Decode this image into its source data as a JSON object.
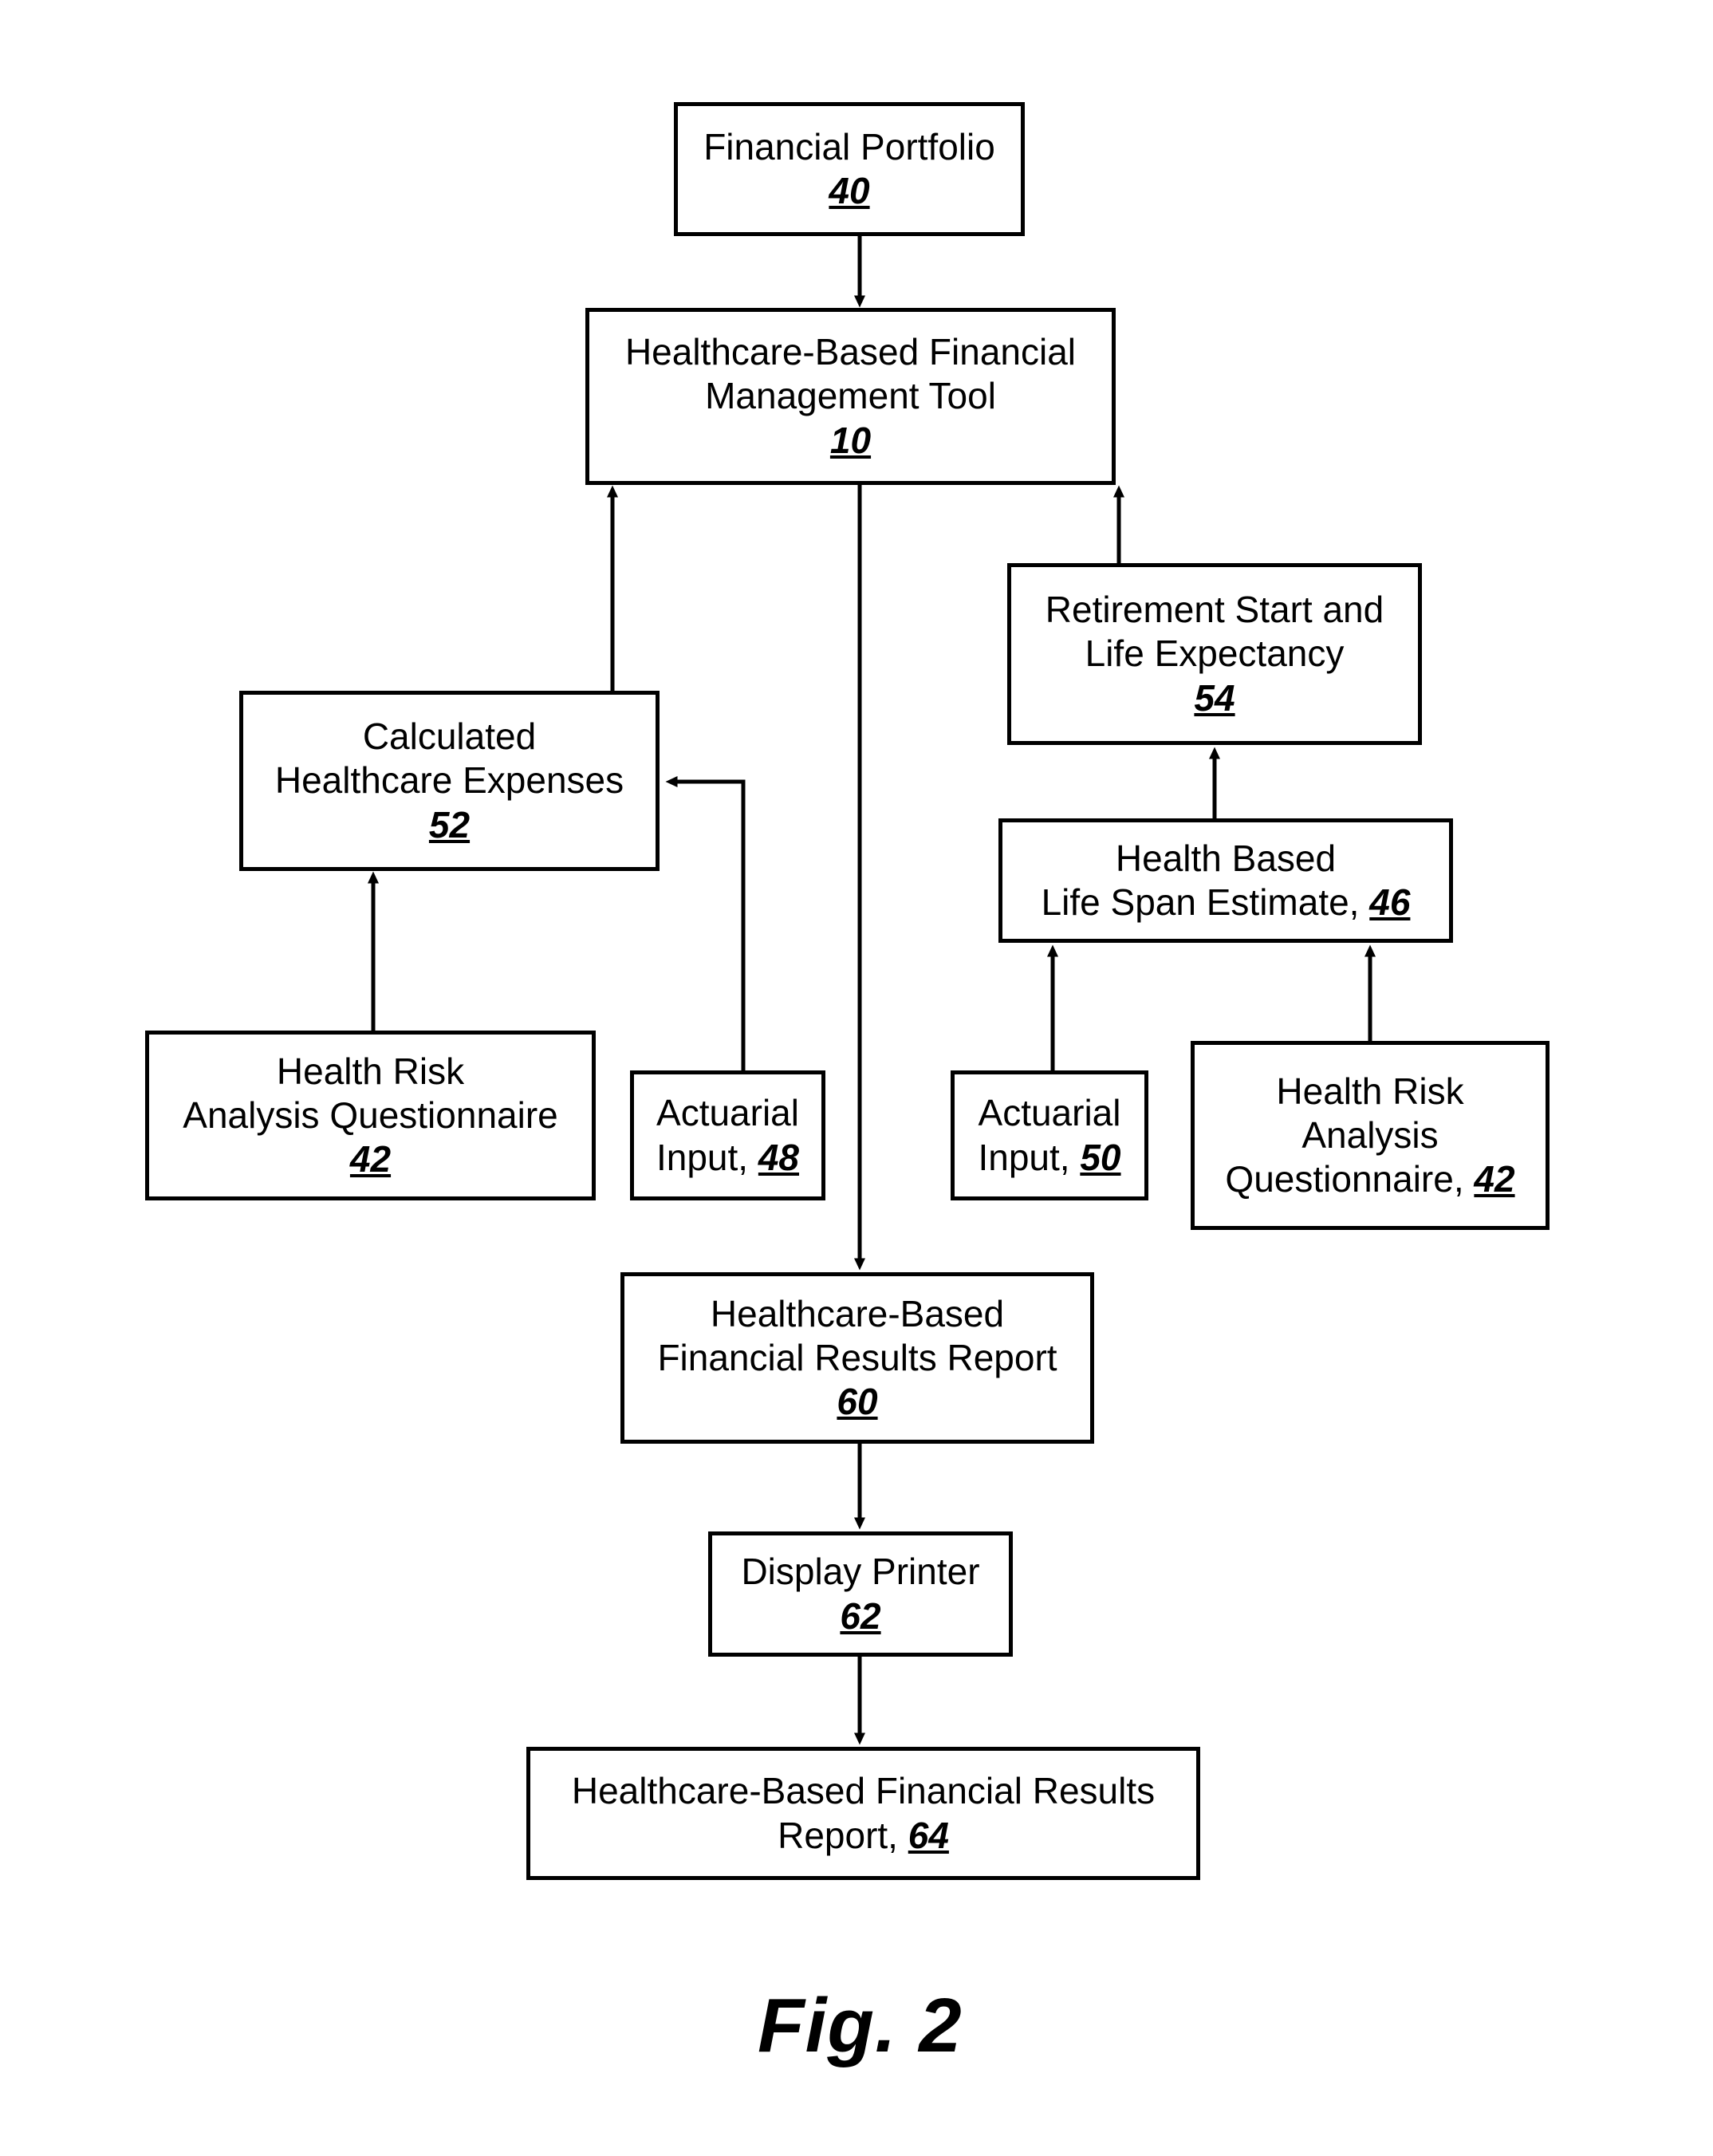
{
  "figure": {
    "caption": "Fig. 2",
    "ink_color": "#000000",
    "background_color": "#ffffff"
  },
  "nodes": {
    "portfolio": {
      "line1": "Financial Portfolio",
      "ref": "40"
    },
    "tool": {
      "line1": "Healthcare-Based Financial",
      "line2": "Management Tool",
      "ref": "10"
    },
    "retirement": {
      "line1": "Retirement Start and",
      "line2": "Life Expectancy",
      "ref": "54"
    },
    "expenses": {
      "line1": "Calculated",
      "line2": "Healthcare Expenses",
      "ref": "52"
    },
    "lifespan": {
      "line1": "Health Based",
      "line2": "Life Span Estimate,",
      "ref": "46"
    },
    "hraq_left": {
      "line1": "Health Risk",
      "line2": "Analysis Questionnaire",
      "ref": "42"
    },
    "actuarial_48": {
      "line1": "Actuarial",
      "line2": "Input,",
      "ref": "48"
    },
    "actuarial_50": {
      "line1": "Actuarial",
      "line2": "Input,",
      "ref": "50"
    },
    "hraq_right": {
      "line1": "Health Risk",
      "line2": "Analysis",
      "line3": "Questionnaire,",
      "ref": "42"
    },
    "results_60": {
      "line1": "Healthcare-Based",
      "line2": "Financial Results Report",
      "ref": "60"
    },
    "display_62": {
      "line1": "Display Printer",
      "ref": "62"
    },
    "results_64": {
      "line1": "Healthcare-Based Financial Results",
      "line2": "Report,",
      "ref": "64"
    }
  },
  "connections": [
    {
      "from": "portfolio",
      "to": "tool",
      "style": "arrow-down"
    },
    {
      "from": "expenses",
      "to": "tool",
      "style": "arrow-up"
    },
    {
      "from": "retirement",
      "to": "tool",
      "style": "arrow-up"
    },
    {
      "from": "tool",
      "to": "results_60",
      "style": "arrow-down"
    },
    {
      "from": "hraq_left",
      "to": "expenses",
      "style": "arrow-up"
    },
    {
      "from": "actuarial_48",
      "to": "expenses",
      "style": "elbow-arrow-left"
    },
    {
      "from": "lifespan",
      "to": "retirement",
      "style": "arrow-up"
    },
    {
      "from": "actuarial_50",
      "to": "lifespan",
      "style": "arrow-up"
    },
    {
      "from": "hraq_right",
      "to": "lifespan",
      "style": "arrow-up"
    },
    {
      "from": "results_60",
      "to": "display_62",
      "style": "arrow-down"
    },
    {
      "from": "display_62",
      "to": "results_64",
      "style": "arrow-down"
    }
  ]
}
